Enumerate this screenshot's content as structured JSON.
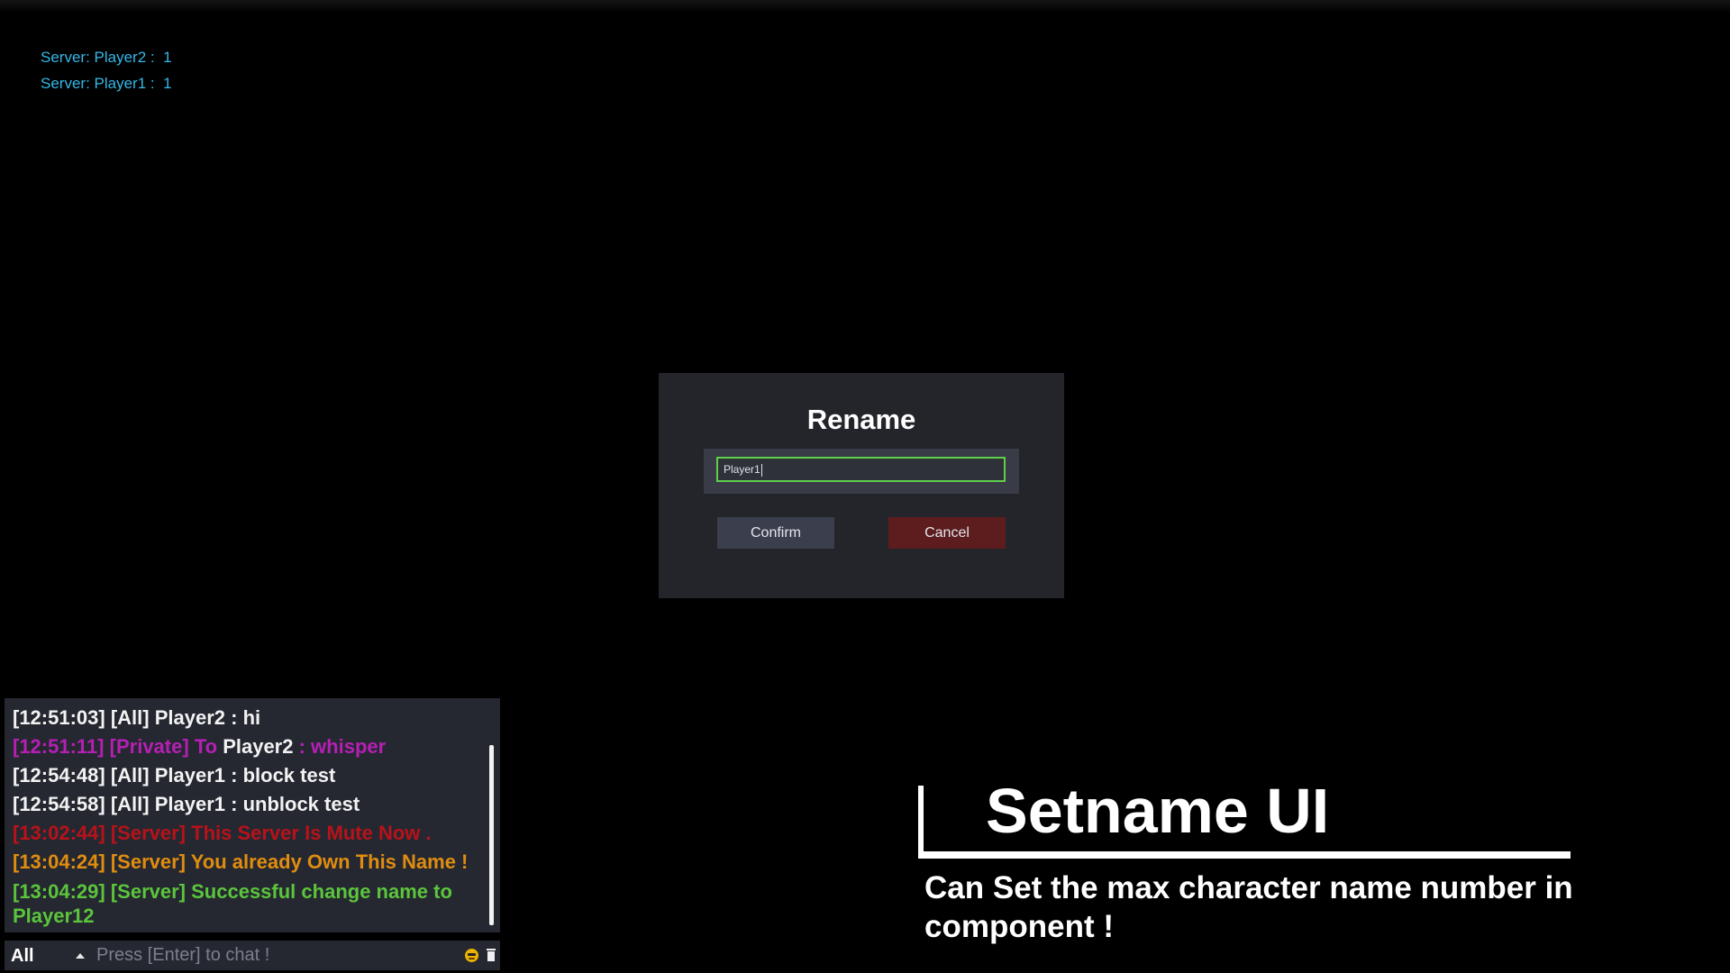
{
  "server_log": [
    {
      "label": "Server: Player2 :",
      "value": "1"
    },
    {
      "label": "Server: Player1 :",
      "value": "1"
    }
  ],
  "dialog": {
    "title": "Rename",
    "input_value": "Player1",
    "confirm_label": "Confirm",
    "cancel_label": "Cancel"
  },
  "chat": {
    "messages": [
      {
        "time": "[12:51:03]",
        "channel": "[All]",
        "body": "Player2 : hi"
      },
      {
        "time": "[12:51:11]",
        "channel": "[Private]",
        "prefix": "To",
        "name": "Player2",
        "body": ": whisper"
      },
      {
        "time": "[12:54:48]",
        "channel": "[All]",
        "body": "Player1 : block test"
      },
      {
        "time": "[12:54:58]",
        "channel": "[All]",
        "body": "Player1 : unblock test"
      },
      {
        "time": "[13:02:44]",
        "channel": "[Server]",
        "body": "This Server Is Mute Now ."
      },
      {
        "time": "[13:04:24]",
        "channel": "[Server]",
        "body": "You already Own This Name !"
      },
      {
        "time": "[13:04:29]",
        "channel": "[Server]",
        "body": "Successful change name to Player12"
      }
    ],
    "channel": "All",
    "input_placeholder": "Press [Enter] to chat !",
    "colors": {
      "all": "#f2f2f2",
      "private": "#b61fb4",
      "server_error": "#b8121a",
      "server_warning": "#e08d10",
      "server_success": "#5bc53b"
    },
    "icons": [
      "emoji-icon",
      "trash-icon"
    ]
  },
  "promo": {
    "title": "Setname UI",
    "subtitle": "Can Set the max character name number in component !"
  }
}
